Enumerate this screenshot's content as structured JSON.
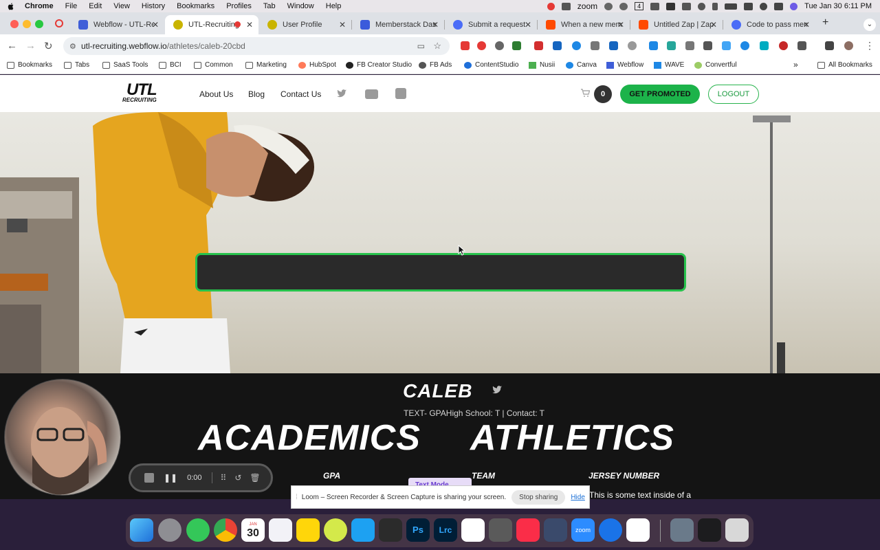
{
  "menubar": {
    "items": [
      "Chrome",
      "File",
      "Edit",
      "View",
      "History",
      "Bookmarks",
      "Profiles",
      "Tab",
      "Window",
      "Help"
    ],
    "zoom_label": "zoom",
    "tray_number": "4",
    "datetime": "Tue Jan 30  6:11 PM"
  },
  "tabs": [
    {
      "title": "Webflow - UTL-Re",
      "active": false,
      "color": "#3f5ed8"
    },
    {
      "title": "UTL-Recruiting",
      "active": true,
      "color": "#c9b400"
    },
    {
      "title": "User Profile",
      "active": false,
      "color": "#c9b400"
    },
    {
      "title": "Memberstack Dash",
      "active": false,
      "color": "#3b5bdb"
    },
    {
      "title": "Submit a request –",
      "active": false,
      "color": "#4a6cf7"
    },
    {
      "title": "When a new memb",
      "active": false,
      "color": "#ff4a00"
    },
    {
      "title": "Untitled Zap | Zapi",
      "active": false,
      "color": "#ff4a00"
    },
    {
      "title": "Code to pass mem",
      "active": false,
      "color": "#4a6cf7"
    }
  ],
  "address": {
    "url_host": "utl-recruiting.webflow.io",
    "url_path": "/athletes/caleb-20cbd"
  },
  "bookmarks": {
    "items": [
      "Bookmarks",
      "Tabs",
      "SaaS Tools",
      "BCI",
      "Common",
      "Marketing",
      "HubSpot",
      "FB Creator Studio",
      "FB Ads",
      "ContentStudio",
      "Nusii",
      "Canva",
      "Webflow",
      "WAVE",
      "Convertful"
    ],
    "overflow": "»",
    "all_bookmarks": "All Bookmarks"
  },
  "site": {
    "logo_text": "UTL",
    "logo_sub": "RECRUITING",
    "nav": [
      "About Us",
      "Blog",
      "Contact Us"
    ],
    "cart_count": "0",
    "promoted_label": "GET PROMOTED",
    "logout_label": "LOGOUT",
    "brand_green": "#1cb34a"
  },
  "profile": {
    "name": "CALEB",
    "meta": "TEXT- GPAHigh School: T | Contact: T",
    "academics_heading": "ACADEMICS",
    "athletics_heading": "ATHLETICS",
    "col_gpa": "GPA",
    "col_team": "TEAM",
    "col_jersey": "JERSEY NUMBER",
    "body_text": "This is some text inside of a"
  },
  "textmode_badge": "Text Mode",
  "loom_share": {
    "message": "Loom – Screen Recorder & Screen Capture is sharing your screen.",
    "stop_label": "Stop sharing",
    "hide_label": "Hide"
  },
  "loom_controls": {
    "time": "0:00"
  },
  "dock": {
    "calendar_month": "JAN",
    "calendar_day": "30"
  }
}
